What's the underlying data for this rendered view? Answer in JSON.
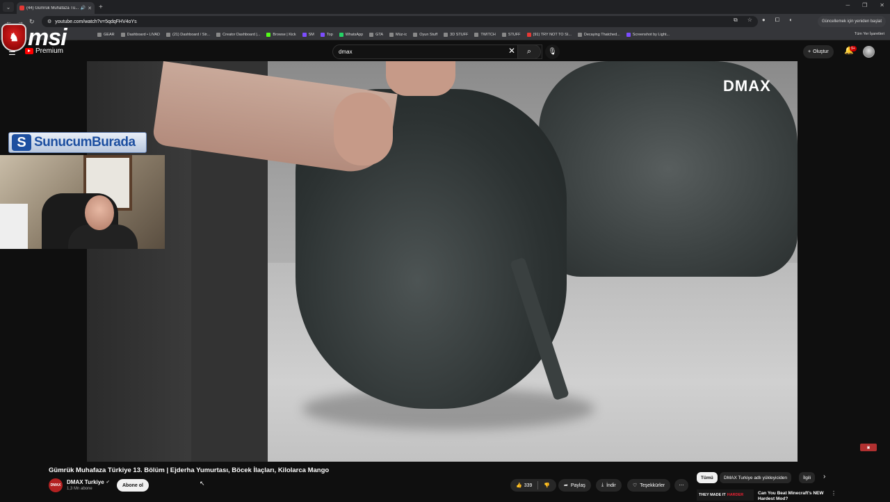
{
  "browser": {
    "tab_title": "(44) Gümrük Muhafaza Tü...",
    "url": "youtube.com/watch?v=5qdqFHV4oYs",
    "update_label": "Güncellemek için yeniden başlat",
    "bookmarks": [
      "GEAR",
      "Dashboard • LIVAD",
      "(21) Dashboard / Str...",
      "Creator Dashboard |...",
      "Browse | Kick",
      "SM",
      "Top",
      "WhatsApp",
      "GTA",
      "Müz-ic",
      "Oyun Stuff",
      "3D STUFF",
      "TWITCH",
      "STUFF",
      "(91) TRY NOT TO SI...",
      "Decaying Thatched...",
      "Screenshot by Light..."
    ],
    "all_bookmarks_label": "Tüm Yer İşaretleri"
  },
  "overlay": {
    "msi_text": "msi",
    "sunucum_text": "SunucumBurada"
  },
  "youtube": {
    "premium_label": "Premium",
    "search_query": "dmax",
    "create_label": "Oluştur",
    "notification_badge": "9+",
    "video_watermark": "DMAX",
    "video_title": "Gümrük Muhafaza Türkiye 13. Bölüm | Ejderha Yumurtası, Böcek İlaçları, Kilolarca Mango",
    "channel_avatar_text": "DMAX",
    "channel_name": "DMAX Turkiye",
    "subscriber_count": "1,3 Mn abone",
    "subscribe_label": "Abone ol",
    "like_count": "339",
    "share_label": "Paylaş",
    "download_label": "İndir",
    "thanks_label": "Teşekkürler",
    "chips": [
      "Tümü",
      "DMAX Turkiye adlı yükleyiciden",
      "İlgili"
    ],
    "rec_thumb_text": "THEY MADE IT",
    "rec_thumb_accent": "HARDER",
    "rec_title": "Can You Beat Minecraft's NEW Hardest Mod?"
  }
}
